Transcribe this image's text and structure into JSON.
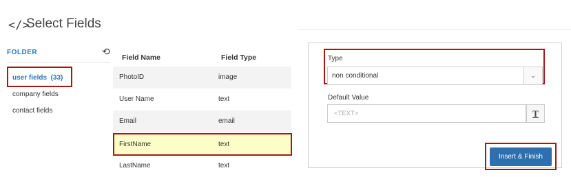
{
  "header": {
    "icon": "</>",
    "title": "Select Fields"
  },
  "folder": {
    "label": "FOLDER",
    "refresh_icon": "⟲",
    "items": [
      {
        "label": "user fields",
        "count": "(33)"
      },
      {
        "label": "company fields"
      },
      {
        "label": "contact fields"
      }
    ]
  },
  "table": {
    "headers": [
      "Field Name",
      "Field Type"
    ],
    "rows": [
      [
        "PhotoID",
        "image"
      ],
      [
        "User Name",
        "text"
      ],
      [
        "Email",
        "email"
      ],
      [
        "FirstName",
        "text"
      ],
      [
        "LastName",
        "text"
      ]
    ]
  },
  "panel": {
    "type_label": "Type",
    "type_value": "non conditional",
    "default_label": "Default Value",
    "default_placeholder": "<TEXT>",
    "text_button": "T",
    "submit_label": "Insert & Finish"
  },
  "colors": {
    "accent": "#2b7bb9",
    "highlight": "#a4161a",
    "button": "#2f6fb0",
    "selected_row": "#fdfdc8"
  }
}
